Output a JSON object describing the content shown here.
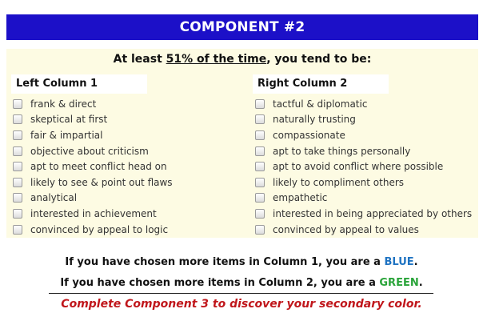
{
  "header": {
    "title": "COMPONENT #2"
  },
  "intro": {
    "prefix": "At least ",
    "emphasis": "51% of the time",
    "suffix": ", you tend to be:"
  },
  "left_column": {
    "title": "Left Column 1",
    "items": [
      "frank & direct",
      "skeptical at first",
      "fair & impartial",
      "objective about criticism",
      "apt to meet conflict head on",
      "likely to see & point out flaws",
      "analytical",
      "interested in achievement",
      "convinced by appeal to logic"
    ]
  },
  "right_column": {
    "title": "Right Column 2",
    "items": [
      "tactful & diplomatic",
      "naturally trusting",
      "compassionate",
      "apt to take things personally",
      "apt to avoid conflict where possible",
      "likely to compliment others",
      "empathetic",
      "interested in being appreciated by others",
      "convinced by appeal to values"
    ]
  },
  "results": {
    "line1_prefix": "If you have chosen more items in Column 1, you are a ",
    "line1_color_word": "BLUE",
    "line1_suffix": ".",
    "line2_prefix": "If you have chosen more items in Column 2, you are a ",
    "line2_color_word": "GREEN",
    "line2_suffix": "."
  },
  "cta": {
    "text": "Complete Component 3 to discover your secondary color."
  },
  "colors": {
    "header_bg": "#1c10c8",
    "panel_bg": "#fdfbe3",
    "blue_word": "#1f73c2",
    "green_word": "#2aa43a",
    "cta_text": "#c0161b"
  },
  "icons": {
    "checkbox": "checkbox-icon"
  }
}
